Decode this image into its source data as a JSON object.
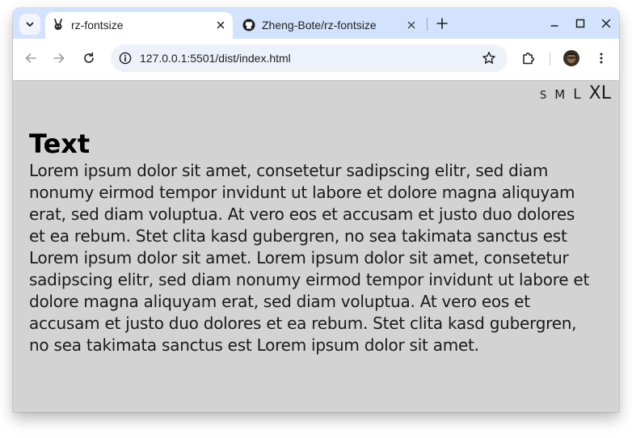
{
  "browser": {
    "tabs": [
      {
        "title": "rz-fontsize",
        "favicon": "bunny-favicon-icon",
        "active": true
      },
      {
        "title": "Zheng-Bote/rz-fontsize",
        "favicon": "github-icon",
        "active": false
      }
    ],
    "url": "127.0.0.1:5501/dist/index.html"
  },
  "page": {
    "size_options": [
      "S",
      "M",
      "L",
      "XL"
    ],
    "heading": "Text",
    "body": "Lorem ipsum dolor sit amet, consetetur sadipscing elitr, sed diam nonumy eirmod tempor invidunt ut labore et dolore magna aliquyam erat, sed diam voluptua. At vero eos et accusam et justo duo dolores et ea rebum. Stet clita kasd gubergren, no sea takimata sanctus est Lorem ipsum dolor sit amet. Lorem ipsum dolor sit amet, consetetur sadipscing elitr, sed diam nonumy eirmod tempor invidunt ut labore et dolore magna aliquyam erat, sed diam voluptua. At vero eos et accusam et justo duo dolores et ea rebum. Stet clita kasd gubergren, no sea takimata sanctus est Lorem ipsum dolor sit amet."
  },
  "colors": {
    "tabstrip": "#d3e3fd",
    "page_background": "#d3d3d3",
    "omnibox": "#edf1f9"
  }
}
